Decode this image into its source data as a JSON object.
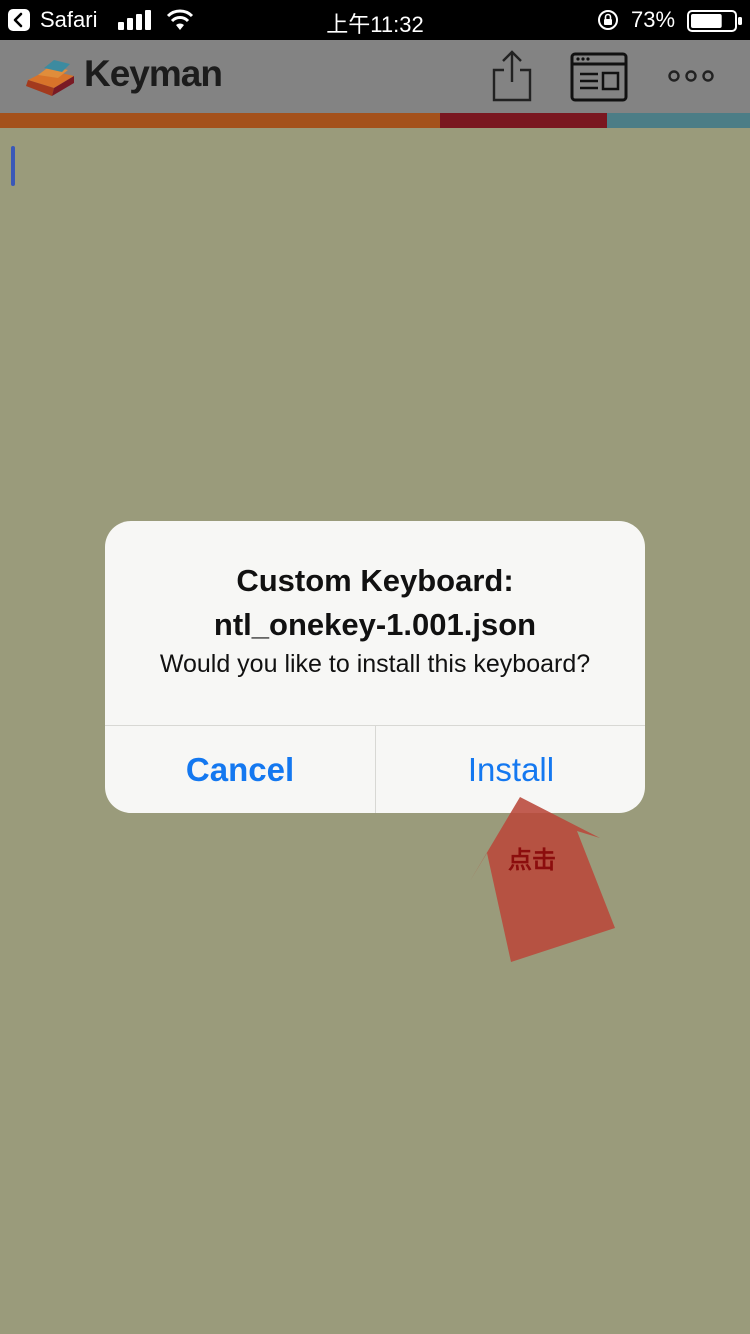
{
  "status_bar": {
    "back_app": "Safari",
    "time": "上午11:32",
    "battery_percent": "73%",
    "battery_level": 0.73
  },
  "app_bar": {
    "logo_text": "Keyman",
    "icons": [
      "share-icon",
      "reader-view-icon",
      "more-icon"
    ],
    "stripe_colors": [
      "#a4511b",
      "#7a1720",
      "#4c7d86"
    ]
  },
  "dialog": {
    "title_line1": "Custom Keyboard:",
    "title_line2": "ntl_onekey-1.001.json",
    "message": "Would you like to install this keyboard?",
    "cancel_label": "Cancel",
    "install_label": "Install",
    "button_color": "#1478f0"
  },
  "annotation": {
    "label": "点击",
    "color": "#b9483a"
  }
}
